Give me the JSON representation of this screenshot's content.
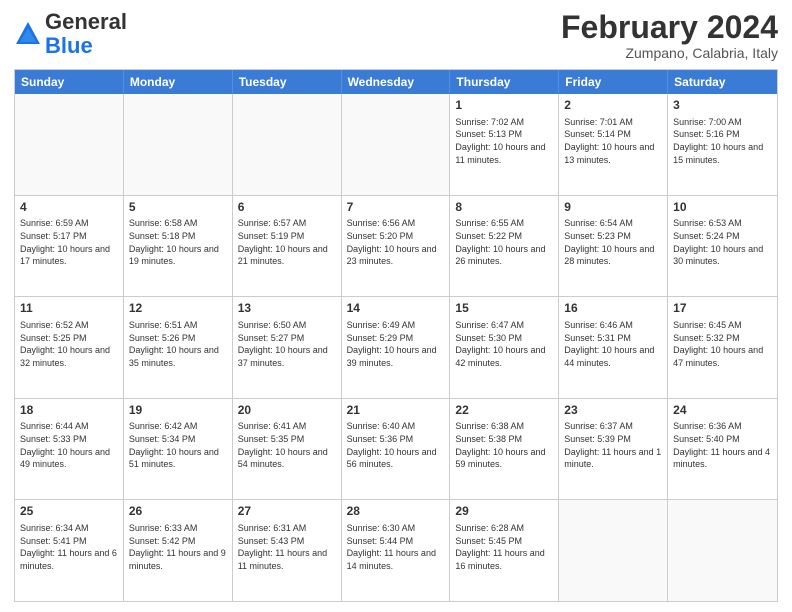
{
  "header": {
    "logo_general": "General",
    "logo_blue": "Blue",
    "month_year": "February 2024",
    "location": "Zumpano, Calabria, Italy"
  },
  "days_of_week": [
    "Sunday",
    "Monday",
    "Tuesday",
    "Wednesday",
    "Thursday",
    "Friday",
    "Saturday"
  ],
  "weeks": [
    [
      {
        "day": "",
        "sunrise": "",
        "sunset": "",
        "daylight": "",
        "empty": true
      },
      {
        "day": "",
        "sunrise": "",
        "sunset": "",
        "daylight": "",
        "empty": true
      },
      {
        "day": "",
        "sunrise": "",
        "sunset": "",
        "daylight": "",
        "empty": true
      },
      {
        "day": "",
        "sunrise": "",
        "sunset": "",
        "daylight": "",
        "empty": true
      },
      {
        "day": "1",
        "sunrise": "Sunrise: 7:02 AM",
        "sunset": "Sunset: 5:13 PM",
        "daylight": "Daylight: 10 hours and 11 minutes.",
        "empty": false
      },
      {
        "day": "2",
        "sunrise": "Sunrise: 7:01 AM",
        "sunset": "Sunset: 5:14 PM",
        "daylight": "Daylight: 10 hours and 13 minutes.",
        "empty": false
      },
      {
        "day": "3",
        "sunrise": "Sunrise: 7:00 AM",
        "sunset": "Sunset: 5:16 PM",
        "daylight": "Daylight: 10 hours and 15 minutes.",
        "empty": false
      }
    ],
    [
      {
        "day": "4",
        "sunrise": "Sunrise: 6:59 AM",
        "sunset": "Sunset: 5:17 PM",
        "daylight": "Daylight: 10 hours and 17 minutes.",
        "empty": false
      },
      {
        "day": "5",
        "sunrise": "Sunrise: 6:58 AM",
        "sunset": "Sunset: 5:18 PM",
        "daylight": "Daylight: 10 hours and 19 minutes.",
        "empty": false
      },
      {
        "day": "6",
        "sunrise": "Sunrise: 6:57 AM",
        "sunset": "Sunset: 5:19 PM",
        "daylight": "Daylight: 10 hours and 21 minutes.",
        "empty": false
      },
      {
        "day": "7",
        "sunrise": "Sunrise: 6:56 AM",
        "sunset": "Sunset: 5:20 PM",
        "daylight": "Daylight: 10 hours and 23 minutes.",
        "empty": false
      },
      {
        "day": "8",
        "sunrise": "Sunrise: 6:55 AM",
        "sunset": "Sunset: 5:22 PM",
        "daylight": "Daylight: 10 hours and 26 minutes.",
        "empty": false
      },
      {
        "day": "9",
        "sunrise": "Sunrise: 6:54 AM",
        "sunset": "Sunset: 5:23 PM",
        "daylight": "Daylight: 10 hours and 28 minutes.",
        "empty": false
      },
      {
        "day": "10",
        "sunrise": "Sunrise: 6:53 AM",
        "sunset": "Sunset: 5:24 PM",
        "daylight": "Daylight: 10 hours and 30 minutes.",
        "empty": false
      }
    ],
    [
      {
        "day": "11",
        "sunrise": "Sunrise: 6:52 AM",
        "sunset": "Sunset: 5:25 PM",
        "daylight": "Daylight: 10 hours and 32 minutes.",
        "empty": false
      },
      {
        "day": "12",
        "sunrise": "Sunrise: 6:51 AM",
        "sunset": "Sunset: 5:26 PM",
        "daylight": "Daylight: 10 hours and 35 minutes.",
        "empty": false
      },
      {
        "day": "13",
        "sunrise": "Sunrise: 6:50 AM",
        "sunset": "Sunset: 5:27 PM",
        "daylight": "Daylight: 10 hours and 37 minutes.",
        "empty": false
      },
      {
        "day": "14",
        "sunrise": "Sunrise: 6:49 AM",
        "sunset": "Sunset: 5:29 PM",
        "daylight": "Daylight: 10 hours and 39 minutes.",
        "empty": false
      },
      {
        "day": "15",
        "sunrise": "Sunrise: 6:47 AM",
        "sunset": "Sunset: 5:30 PM",
        "daylight": "Daylight: 10 hours and 42 minutes.",
        "empty": false
      },
      {
        "day": "16",
        "sunrise": "Sunrise: 6:46 AM",
        "sunset": "Sunset: 5:31 PM",
        "daylight": "Daylight: 10 hours and 44 minutes.",
        "empty": false
      },
      {
        "day": "17",
        "sunrise": "Sunrise: 6:45 AM",
        "sunset": "Sunset: 5:32 PM",
        "daylight": "Daylight: 10 hours and 47 minutes.",
        "empty": false
      }
    ],
    [
      {
        "day": "18",
        "sunrise": "Sunrise: 6:44 AM",
        "sunset": "Sunset: 5:33 PM",
        "daylight": "Daylight: 10 hours and 49 minutes.",
        "empty": false
      },
      {
        "day": "19",
        "sunrise": "Sunrise: 6:42 AM",
        "sunset": "Sunset: 5:34 PM",
        "daylight": "Daylight: 10 hours and 51 minutes.",
        "empty": false
      },
      {
        "day": "20",
        "sunrise": "Sunrise: 6:41 AM",
        "sunset": "Sunset: 5:35 PM",
        "daylight": "Daylight: 10 hours and 54 minutes.",
        "empty": false
      },
      {
        "day": "21",
        "sunrise": "Sunrise: 6:40 AM",
        "sunset": "Sunset: 5:36 PM",
        "daylight": "Daylight: 10 hours and 56 minutes.",
        "empty": false
      },
      {
        "day": "22",
        "sunrise": "Sunrise: 6:38 AM",
        "sunset": "Sunset: 5:38 PM",
        "daylight": "Daylight: 10 hours and 59 minutes.",
        "empty": false
      },
      {
        "day": "23",
        "sunrise": "Sunrise: 6:37 AM",
        "sunset": "Sunset: 5:39 PM",
        "daylight": "Daylight: 11 hours and 1 minute.",
        "empty": false
      },
      {
        "day": "24",
        "sunrise": "Sunrise: 6:36 AM",
        "sunset": "Sunset: 5:40 PM",
        "daylight": "Daylight: 11 hours and 4 minutes.",
        "empty": false
      }
    ],
    [
      {
        "day": "25",
        "sunrise": "Sunrise: 6:34 AM",
        "sunset": "Sunset: 5:41 PM",
        "daylight": "Daylight: 11 hours and 6 minutes.",
        "empty": false
      },
      {
        "day": "26",
        "sunrise": "Sunrise: 6:33 AM",
        "sunset": "Sunset: 5:42 PM",
        "daylight": "Daylight: 11 hours and 9 minutes.",
        "empty": false
      },
      {
        "day": "27",
        "sunrise": "Sunrise: 6:31 AM",
        "sunset": "Sunset: 5:43 PM",
        "daylight": "Daylight: 11 hours and 11 minutes.",
        "empty": false
      },
      {
        "day": "28",
        "sunrise": "Sunrise: 6:30 AM",
        "sunset": "Sunset: 5:44 PM",
        "daylight": "Daylight: 11 hours and 14 minutes.",
        "empty": false
      },
      {
        "day": "29",
        "sunrise": "Sunrise: 6:28 AM",
        "sunset": "Sunset: 5:45 PM",
        "daylight": "Daylight: 11 hours and 16 minutes.",
        "empty": false
      },
      {
        "day": "",
        "sunrise": "",
        "sunset": "",
        "daylight": "",
        "empty": true
      },
      {
        "day": "",
        "sunrise": "",
        "sunset": "",
        "daylight": "",
        "empty": true
      }
    ]
  ]
}
